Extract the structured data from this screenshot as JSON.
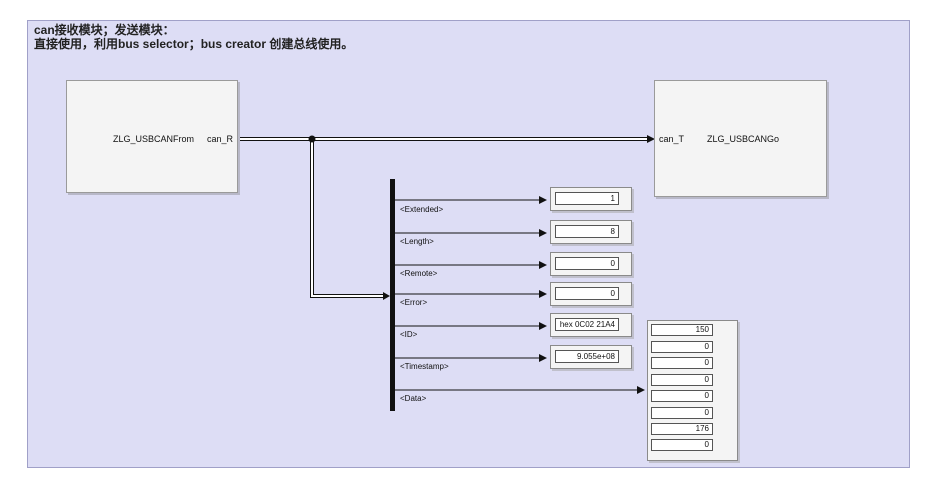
{
  "annotation": {
    "line1": "can接收模块；发送模块：",
    "line2": "直接使用，利用bus selector；bus creator 创建总线使用。"
  },
  "blocks": {
    "from": {
      "name": "ZLG_USBCANFrom",
      "port": "can_R"
    },
    "go": {
      "name": "ZLG_USBCANGo",
      "port": "can_T"
    }
  },
  "bus_selector": {
    "signals": [
      "<Extended>",
      "<Length>",
      "<Remote>",
      "<Error>",
      "<ID>",
      "<Timestamp>",
      "<Data>"
    ]
  },
  "displays": [
    "1",
    "8",
    "0",
    "0",
    "hex 0C02 21A4",
    "9.055e+08"
  ],
  "data_display": [
    "150",
    "0",
    "0",
    "0",
    "0",
    "0",
    "176",
    "0"
  ],
  "colors": {
    "annotation_bg": "#ddddf5",
    "block_bg": "#f4f4f4",
    "line": "#111111"
  }
}
